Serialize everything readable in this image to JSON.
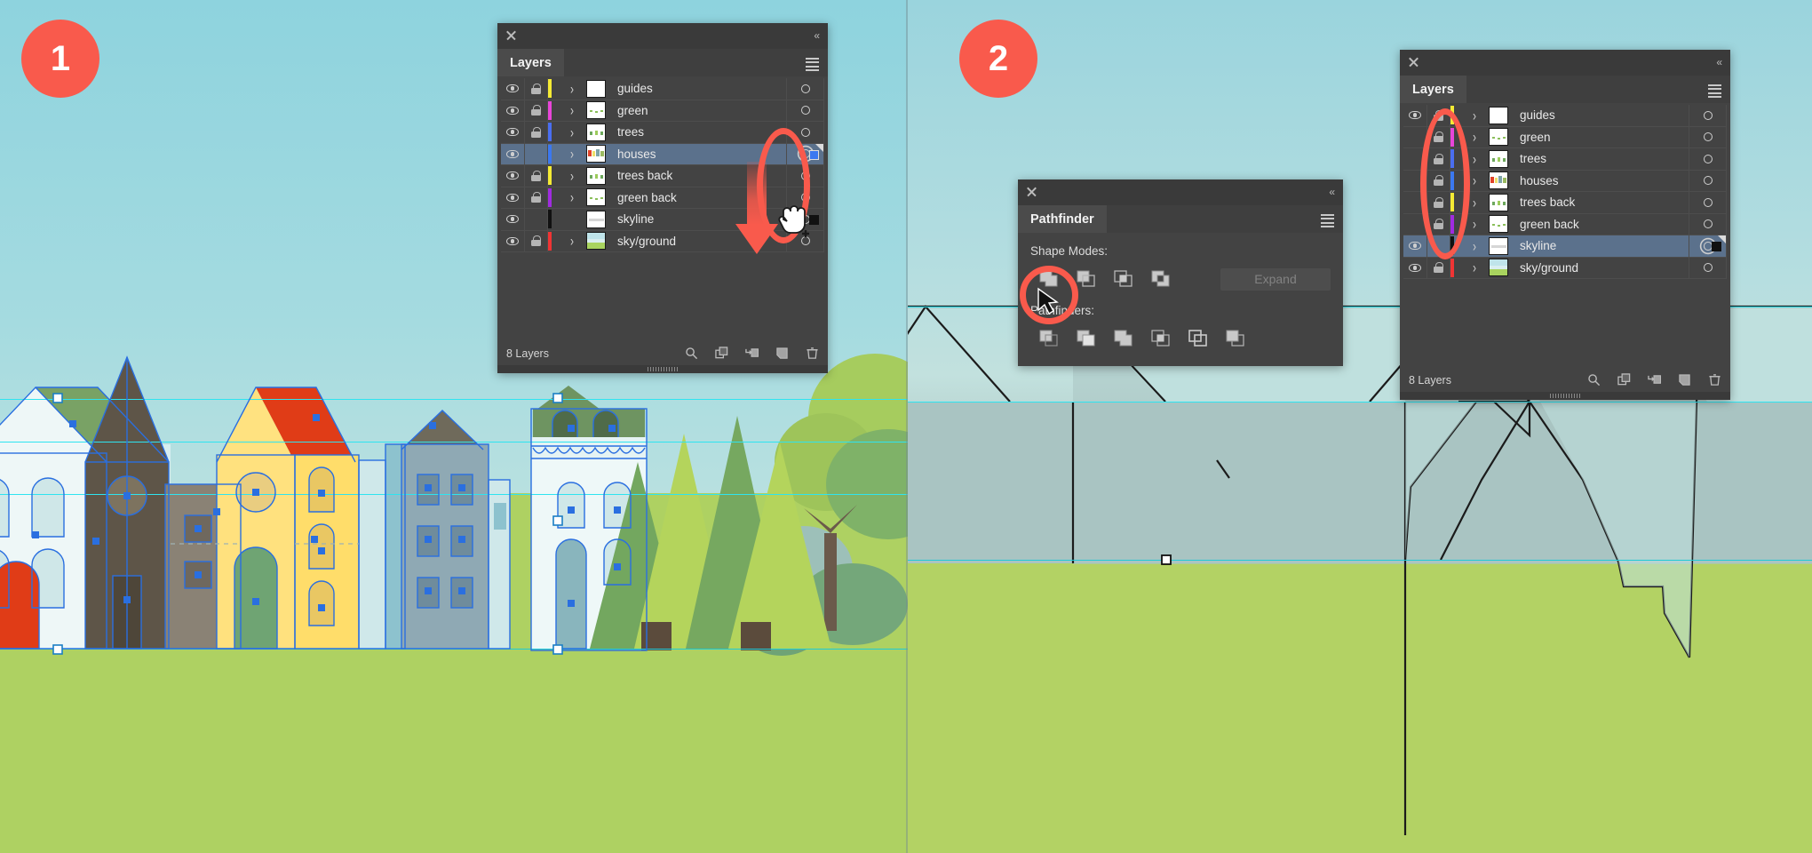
{
  "steps": [
    {
      "number": "1"
    },
    {
      "number": "2"
    }
  ],
  "panel1": {
    "tab_label": "Layers",
    "close_icon": "close-icon",
    "collapse_icon": "collapse-icon",
    "menu_icon": "panel-menu-icon",
    "footer_count": "8 Layers",
    "footer_icons": [
      "locate-object-icon",
      "make-sublayer-icon",
      "release-to-layers-icon",
      "new-layer-icon",
      "delete-layer-icon"
    ],
    "rows": [
      {
        "name": "guides",
        "visible": true,
        "locked": true,
        "color": "#f4ea34",
        "selected": false,
        "expandable": true,
        "target_selected": false
      },
      {
        "name": "green",
        "visible": true,
        "locked": true,
        "color": "#e845d8",
        "selected": false,
        "expandable": true,
        "target_selected": false
      },
      {
        "name": "trees",
        "visible": true,
        "locked": true,
        "color": "#4a6ef0",
        "selected": false,
        "expandable": true,
        "target_selected": false
      },
      {
        "name": "houses",
        "visible": true,
        "locked": false,
        "color": "#3b78f0",
        "selected": true,
        "expandable": true,
        "target_selected": true
      },
      {
        "name": "trees back",
        "visible": true,
        "locked": true,
        "color": "#f4ea34",
        "selected": false,
        "expandable": true,
        "target_selected": false
      },
      {
        "name": "green back",
        "visible": true,
        "locked": true,
        "color": "#a02be0",
        "selected": false,
        "expandable": true,
        "target_selected": false
      },
      {
        "name": "skyline",
        "visible": true,
        "locked": false,
        "color": "#111111",
        "selected": false,
        "expandable": false,
        "target_selected": false
      },
      {
        "name": "sky/ground",
        "visible": true,
        "locked": true,
        "color": "#f03434",
        "selected": false,
        "expandable": true,
        "target_selected": false
      }
    ]
  },
  "panel2": {
    "tab_label": "Layers",
    "close_icon": "close-icon",
    "collapse_icon": "collapse-icon",
    "menu_icon": "panel-menu-icon",
    "footer_count": "8 Layers",
    "footer_icons": [
      "locate-object-icon",
      "make-sublayer-icon",
      "release-to-layers-icon",
      "new-layer-icon",
      "delete-layer-icon"
    ],
    "rows": [
      {
        "name": "guides",
        "visible": true,
        "locked": true,
        "color": "#f4ea34",
        "selected": false,
        "expandable": true,
        "target_selected": false
      },
      {
        "name": "green",
        "visible": false,
        "locked": true,
        "color": "#e845d8",
        "selected": false,
        "expandable": true,
        "target_selected": false
      },
      {
        "name": "trees",
        "visible": false,
        "locked": true,
        "color": "#4a6ef0",
        "selected": false,
        "expandable": true,
        "target_selected": false
      },
      {
        "name": "houses",
        "visible": false,
        "locked": true,
        "color": "#3b78f0",
        "selected": false,
        "expandable": true,
        "target_selected": false
      },
      {
        "name": "trees back",
        "visible": false,
        "locked": true,
        "color": "#f4ea34",
        "selected": false,
        "expandable": true,
        "target_selected": false
      },
      {
        "name": "green back",
        "visible": false,
        "locked": true,
        "color": "#a02be0",
        "selected": false,
        "expandable": true,
        "target_selected": false
      },
      {
        "name": "skyline",
        "visible": true,
        "locked": false,
        "color": "#111111",
        "selected": true,
        "expandable": true,
        "target_selected": true
      },
      {
        "name": "sky/ground",
        "visible": true,
        "locked": true,
        "color": "#f03434",
        "selected": false,
        "expandable": true,
        "target_selected": false
      }
    ]
  },
  "pathfinder": {
    "tab_label": "Pathfinder",
    "close_icon": "close-icon",
    "collapse_icon": "collapse-icon",
    "menu_icon": "panel-menu-icon",
    "shape_modes_label": "Shape Modes:",
    "pathfinders_label": "Pathfinders:",
    "expand_label": "Expand",
    "shape_mode_buttons": [
      "unite-icon",
      "minus-front-icon",
      "intersect-icon",
      "exclude-icon"
    ],
    "pathfinder_buttons": [
      "divide-icon",
      "trim-icon",
      "merge-icon",
      "crop-icon",
      "outline-icon",
      "minus-back-icon"
    ]
  },
  "annotations": {
    "drag_arrow": "red-down-arrow",
    "highlight_ellipse_1": "target-column-highlight",
    "highlight_ellipse_2": "lock-column-highlight",
    "highlight_ellipse_3": "unite-button-highlight",
    "cursor_hand": "hand-cursor-with-plus",
    "cursor_arrow": "arrow-cursor"
  },
  "colors": {
    "accent_red": "#f95a4c",
    "panel_bg": "#434343",
    "row_selected": "#5b718c",
    "guide_cyan": "#2ee4f0",
    "selection_blue": "#2a6fe0",
    "ground_green": "#aed162",
    "sky_top": "#8ed3de"
  }
}
